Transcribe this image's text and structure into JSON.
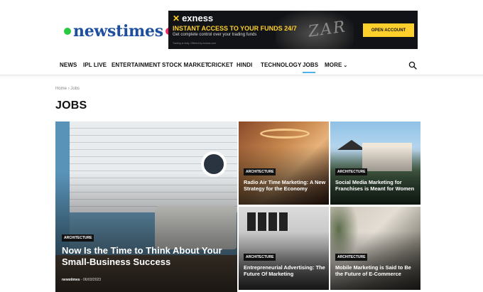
{
  "site": {
    "logo_text": "newstimes",
    "colors": {
      "logo_text": "#1e4f9e",
      "dot_left": "#27c93f",
      "dot_right": "#ff1f6b",
      "accent": "#4db2ec"
    }
  },
  "ad": {
    "brand": "exness",
    "headline": "INSTANT ACCESS TO YOUR FUNDS 24/7",
    "subline": "Get complete control over your trading funds",
    "fineprint": "Trading is risky. Offered by exness.com",
    "cta": "OPEN ACCOUNT",
    "colors": {
      "background": "#111317",
      "accent": "#ffd02b"
    }
  },
  "nav": {
    "items": [
      {
        "label": "NEWS"
      },
      {
        "label": "IPL LIVE"
      },
      {
        "label": "ENTERTAINMENT"
      },
      {
        "label": "STOCK MARKET"
      },
      {
        "label": "CRICKET"
      },
      {
        "label": "HINDI"
      },
      {
        "label": "TECHNOLOGY"
      },
      {
        "label": "JOBS",
        "active": true
      },
      {
        "label": "MORE"
      }
    ],
    "search_icon": "search-icon"
  },
  "breadcrumb": {
    "home": "Home",
    "separator": "›",
    "current": "Jobs"
  },
  "page": {
    "title": "JOBS"
  },
  "articles": [
    {
      "category": "ARCHITECTURE",
      "title": "Now Is the Time to Think About Your Small-Business Success",
      "author": "newstimes",
      "date": "06/03/2023"
    },
    {
      "category": "ARCHITECTURE",
      "title": "Radio Air Time Marketing: A New Strategy for the Economy"
    },
    {
      "category": "ARCHITECTURE",
      "title": "Social Media Marketing for Franchises is Meant for Women"
    },
    {
      "category": "ARCHITECTURE",
      "title": "Entrepreneurial Advertising: The Future Of Marketing"
    },
    {
      "category": "ARCHITECTURE",
      "title": "Mobile Marketing is Said to Be the Future of E-Commerce"
    }
  ]
}
